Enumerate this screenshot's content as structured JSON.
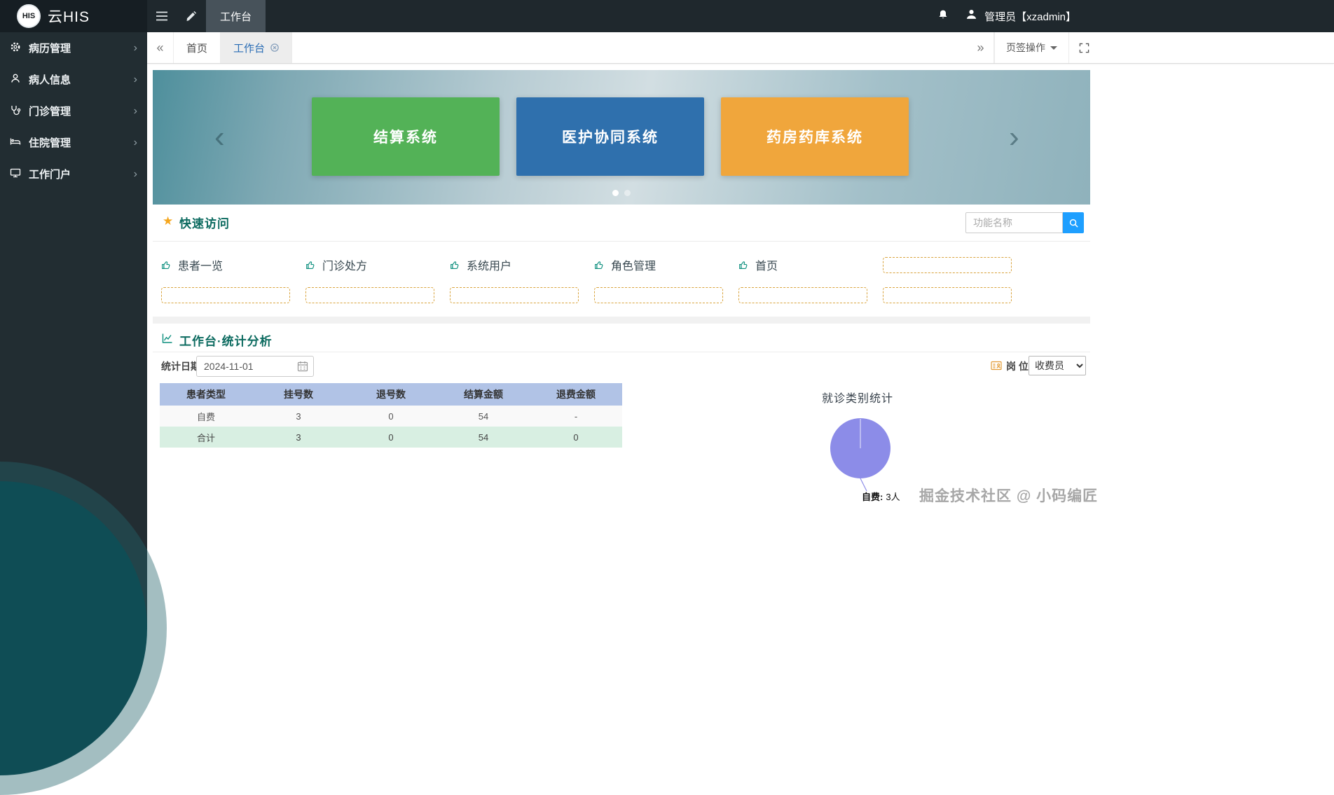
{
  "navbar": {
    "logo_text": "HIS",
    "brand": "云HIS",
    "workspace_tab": "工作台",
    "user": "管理员【xzadmin】"
  },
  "sidebar": {
    "items": [
      {
        "label": "病历管理",
        "icon": "gears-icon"
      },
      {
        "label": "病人信息",
        "icon": "patient-icon"
      },
      {
        "label": "门诊管理",
        "icon": "stethoscope-icon"
      },
      {
        "label": "住院管理",
        "icon": "bed-icon"
      },
      {
        "label": "工作门户",
        "icon": "portal-icon"
      }
    ]
  },
  "tabbar": {
    "prev": "«",
    "next": "»",
    "tabs": [
      {
        "label": "首页",
        "active": false
      },
      {
        "label": "工作台",
        "active": true
      }
    ],
    "actions": "页签操作"
  },
  "carousel": {
    "prev": "‹",
    "next": "›",
    "cards": [
      {
        "label": "结算系统",
        "color": "#53b257"
      },
      {
        "label": "医护协同系统",
        "color": "#2f70ad"
      },
      {
        "label": "药房药库系统",
        "color": "#f0a63c"
      }
    ]
  },
  "quick_access": {
    "title": "快速访问",
    "search_placeholder": "功能名称",
    "links": [
      {
        "label": "患者一览"
      },
      {
        "label": "门诊处方"
      },
      {
        "label": "系统用户"
      },
      {
        "label": "角色管理"
      },
      {
        "label": "首页"
      }
    ]
  },
  "stats": {
    "title": "工作台·统计分析",
    "date_label": "统计日期",
    "date_value": "2024-11-01",
    "post_label": "岗 位",
    "post_value": "收费员",
    "table": {
      "headers": [
        "患者类型",
        "挂号数",
        "退号数",
        "结算金额",
        "退费金额"
      ],
      "rows": [
        [
          "自费",
          "3",
          "0",
          "54",
          "-"
        ],
        [
          "合计",
          "3",
          "0",
          "54",
          "0"
        ]
      ]
    },
    "pie_title": "就诊类别统计",
    "pie_label": "自费:",
    "pie_value": "3人"
  },
  "chart_data": {
    "type": "pie",
    "title": "就诊类别统计",
    "categories": [
      "自费"
    ],
    "values": [
      3
    ],
    "unit": "人",
    "colors": [
      "#8c8ce8"
    ],
    "legend_position": "bottom"
  },
  "watermark": "掘金技术社区 @ 小码编匠"
}
